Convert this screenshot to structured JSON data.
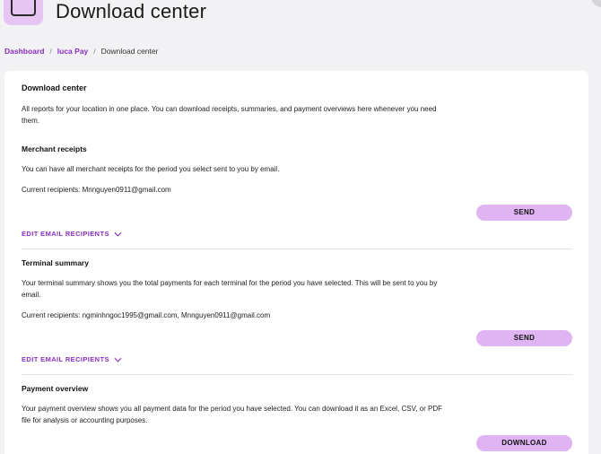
{
  "header": {
    "title": "Download center"
  },
  "breadcrumb": {
    "items": [
      {
        "label": "Dashboard"
      },
      {
        "label": "luca Pay"
      }
    ],
    "separator": "/",
    "current": "Download center"
  },
  "card": {
    "title": "Download center",
    "intro": "All reports for your location in one place. You can download receipts, summaries, and payment overviews here whenever you need them."
  },
  "sections": {
    "merchant": {
      "title": "Merchant receipts",
      "description": "You can have all merchant receipts for the period you select sent to you by email.",
      "recipients": "Current recipients: Mnnguyen0911@gmail.com",
      "button": "SEND",
      "edit_link": "EDIT EMAIL RECIPIENTS"
    },
    "terminal": {
      "title": "Terminal summary",
      "description": "Your terminal summary shows you the total payments for each terminal for the period you have selected. This will be sent to you by email.",
      "recipients": "Current recipients: ngminhngoc1995@gmail.com, Mnnguyen0911@gmail.com",
      "button": "SEND",
      "edit_link": "EDIT EMAIL RECIPIENTS"
    },
    "payment": {
      "title": "Payment overview",
      "description": "Your payment overview shows you all payment data for the period you have selected. You can download it as an Excel, CSV, or PDF file for analysis or accounting purposes.",
      "button": "DOWNLOAD"
    }
  },
  "colors": {
    "accent": "#8a2fc3",
    "button_bg": "#e0b3f3",
    "page_bg": "#f2f2f4"
  },
  "icons": {
    "logo": "app-logo-icon",
    "chevron": "chevron-down-icon"
  }
}
